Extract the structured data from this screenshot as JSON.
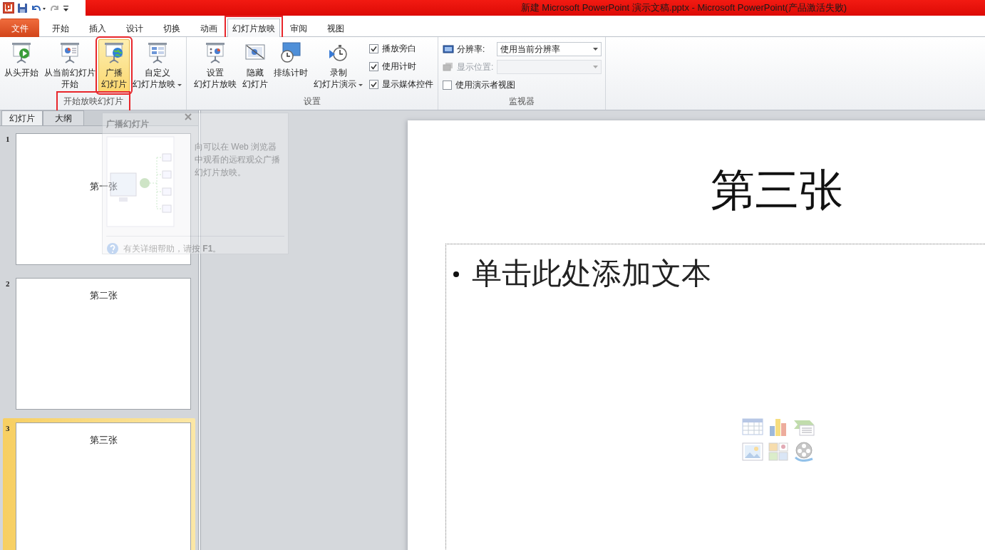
{
  "window": {
    "title": "新建 Microsoft PowerPoint 演示文稿.pptx  -  Microsoft PowerPoint(产品激活失败)"
  },
  "tabs": [
    {
      "label": "文件",
      "kind": "file",
      "selected": false,
      "highlighted": false
    },
    {
      "label": "开始",
      "kind": "tab",
      "selected": false,
      "highlighted": false
    },
    {
      "label": "插入",
      "kind": "tab",
      "selected": false,
      "highlighted": false
    },
    {
      "label": "设计",
      "kind": "tab",
      "selected": false,
      "highlighted": false
    },
    {
      "label": "切换",
      "kind": "tab",
      "selected": false,
      "highlighted": false
    },
    {
      "label": "动画",
      "kind": "tab",
      "selected": false,
      "highlighted": false
    },
    {
      "label": "幻灯片放映",
      "kind": "tab",
      "selected": true,
      "highlighted": true
    },
    {
      "label": "审阅",
      "kind": "tab",
      "selected": false,
      "highlighted": false
    },
    {
      "label": "视图",
      "kind": "tab",
      "selected": false,
      "highlighted": false
    }
  ],
  "ribbon_groups": [
    {
      "label": "开始放映幻灯片",
      "highlighted": true,
      "items": [
        {
          "kind": "large",
          "lines": [
            "从头开始"
          ],
          "dropdown": false,
          "selected": false,
          "highlighted": false
        },
        {
          "kind": "large",
          "lines": [
            "从当前幻灯片",
            "开始"
          ],
          "dropdown": false,
          "selected": false,
          "highlighted": false
        },
        {
          "kind": "large",
          "lines": [
            "广播",
            "幻灯片"
          ],
          "dropdown": false,
          "selected": true,
          "highlighted": true
        },
        {
          "kind": "large",
          "lines": [
            "自定义",
            "幻灯片放映"
          ],
          "dropdown": true,
          "selected": false,
          "highlighted": false
        }
      ]
    },
    {
      "label": "设置",
      "highlighted": false,
      "items": [
        {
          "kind": "large",
          "lines": [
            "设置",
            "幻灯片放映"
          ],
          "dropdown": false,
          "selected": false,
          "highlighted": false
        },
        {
          "kind": "large",
          "lines": [
            "隐藏",
            "幻灯片"
          ],
          "dropdown": false,
          "selected": false,
          "highlighted": false
        },
        {
          "kind": "large",
          "lines": [
            "排练计时"
          ],
          "dropdown": false,
          "selected": false,
          "highlighted": false
        },
        {
          "kind": "large",
          "lines": [
            "录制",
            "幻灯片演示"
          ],
          "dropdown": true,
          "selected": false,
          "highlighted": false
        },
        {
          "kind": "checks",
          "checks": [
            {
              "label": "播放旁白",
              "checked": true
            },
            {
              "label": "使用计时",
              "checked": true
            },
            {
              "label": "显示媒体控件",
              "checked": true
            }
          ]
        }
      ]
    },
    {
      "label": "监视器",
      "highlighted": false,
      "items": [
        {
          "kind": "select",
          "label": "分辨率:",
          "value": "使用当前分辨率",
          "disabled": false
        },
        {
          "kind": "select",
          "label": "显示位置:",
          "disabled": true
        },
        {
          "kind": "checkbox",
          "label": "使用演示者视图",
          "checked": false
        }
      ]
    }
  ],
  "slides_pane": {
    "tabs": [
      {
        "label": "幻灯片",
        "selected": true
      },
      {
        "label": "大纲",
        "selected": false
      }
    ],
    "slides": [
      {
        "number": "1",
        "title": "第一张",
        "selected": false
      },
      {
        "number": "2",
        "title": "第二张",
        "selected": false
      },
      {
        "number": "3",
        "title": "第三张",
        "selected": true
      }
    ]
  },
  "tooltip": {
    "title": "广播幻灯片",
    "text": "向可以在 Web 浏览器中观看的远程观众广播幻灯片放映。",
    "help": "有关详细帮助，请按 **F1**。"
  },
  "slide": {
    "title": "第三张",
    "placeholder": "单击此处添加文本"
  }
}
